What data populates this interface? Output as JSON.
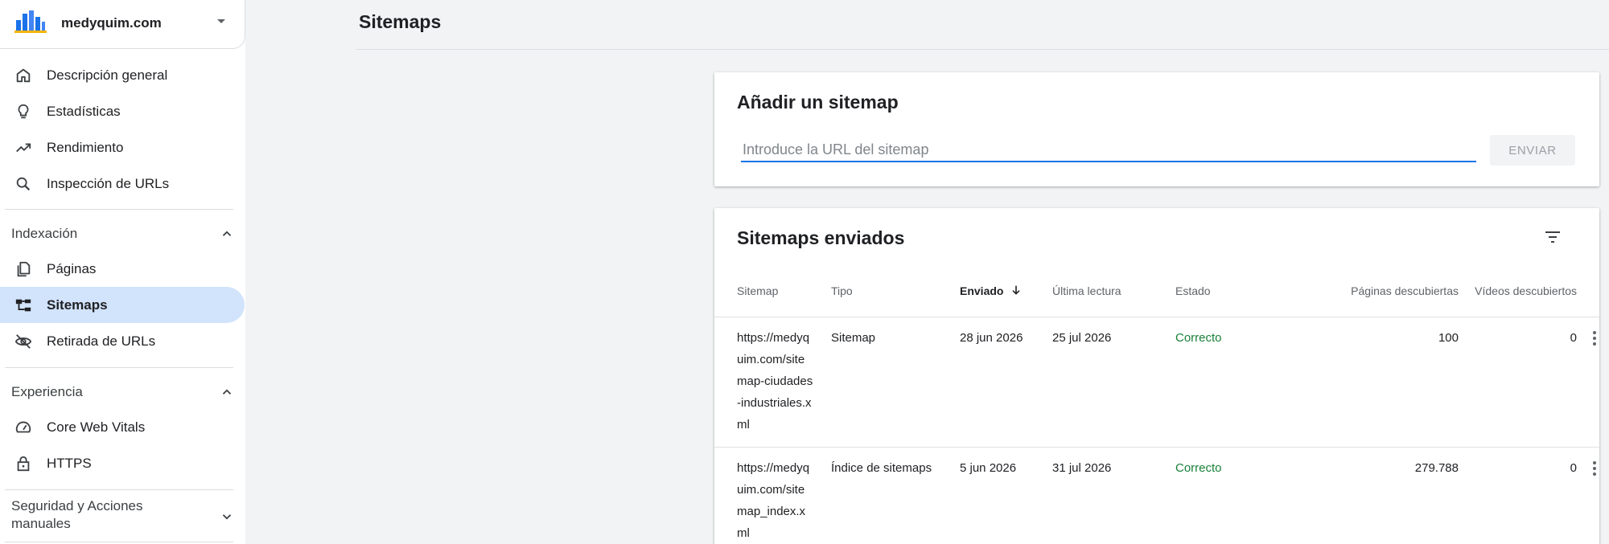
{
  "property": {
    "name": "medyquim.com"
  },
  "nav": {
    "overview": "Descripción general",
    "insights": "Estadísticas",
    "performance": "Rendimiento",
    "url_inspection": "Inspección de URLs",
    "section_indexing": "Indexación",
    "pages": "Páginas",
    "sitemaps": "Sitemaps",
    "removals": "Retirada de URLs",
    "section_experience": "Experiencia",
    "core_web_vitals": "Core Web Vitals",
    "https": "HTTPS",
    "section_security": "Seguridad y Acciones manuales"
  },
  "page": {
    "title": "Sitemaps"
  },
  "add_sitemap": {
    "title": "Añadir un sitemap",
    "placeholder": "Introduce la URL del sitemap",
    "send_label": "ENVIAR"
  },
  "submitted": {
    "title": "Sitemaps enviados",
    "columns": [
      "Sitemap",
      "Tipo",
      "Enviado",
      "Última lectura",
      "Estado",
      "Páginas descubiertas",
      "Vídeos descubiertos"
    ],
    "rows": [
      {
        "sitemap": "https://medyquim.com/sitemap-ciudades-industriales.xml",
        "type": "Sitemap",
        "submitted": "28 jun 2026",
        "last_read": "25 jul 2026",
        "status": "Correcto",
        "pages": "100",
        "videos": "0"
      },
      {
        "sitemap": "https://medyquim.com/sitemap_index.xml",
        "type": "Índice de sitemaps",
        "submitted": "5 jun 2026",
        "last_read": "31 jul 2026",
        "status": "Correcto",
        "pages": "279.788",
        "videos": "0"
      }
    ]
  },
  "colors": {
    "accent": "#1a73e8",
    "active_bg": "#d2e3fc",
    "success": "#188038"
  }
}
